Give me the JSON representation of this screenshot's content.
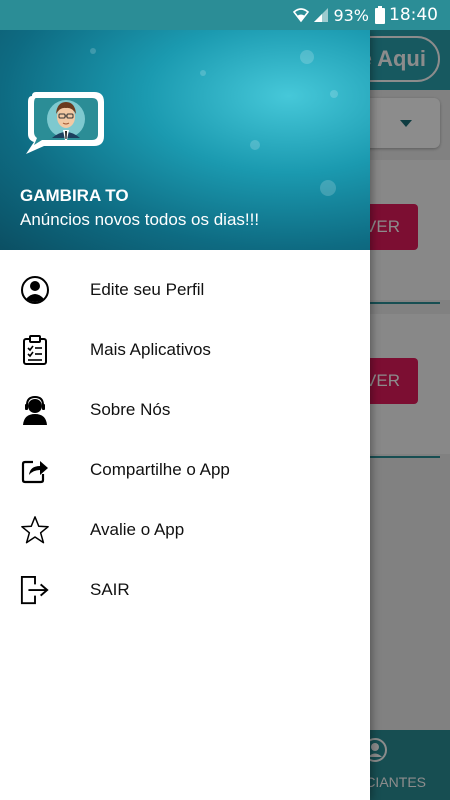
{
  "status_bar": {
    "battery": "93%",
    "time": "18:40"
  },
  "background": {
    "pill_label": "e Aqui",
    "button_label": "VER",
    "nav_label": "CIANTES"
  },
  "drawer": {
    "title": "GAMBIRA TO",
    "subtitle": "Anúncios novos todos os dias!!!",
    "items": [
      {
        "label": "Edite seu Perfil",
        "icon": "profile-icon"
      },
      {
        "label": "Mais Aplicativos",
        "icon": "checklist-icon"
      },
      {
        "label": "Sobre Nós",
        "icon": "headset-user-icon"
      },
      {
        "label": "Compartilhe o App",
        "icon": "share-icon"
      },
      {
        "label": "Avalie o App",
        "icon": "star-icon"
      },
      {
        "label": "SAIR",
        "icon": "exit-icon"
      }
    ]
  },
  "colors": {
    "accent": "#2aa3af",
    "status_bar": "#2b8d96",
    "button": "#e21a5b"
  }
}
